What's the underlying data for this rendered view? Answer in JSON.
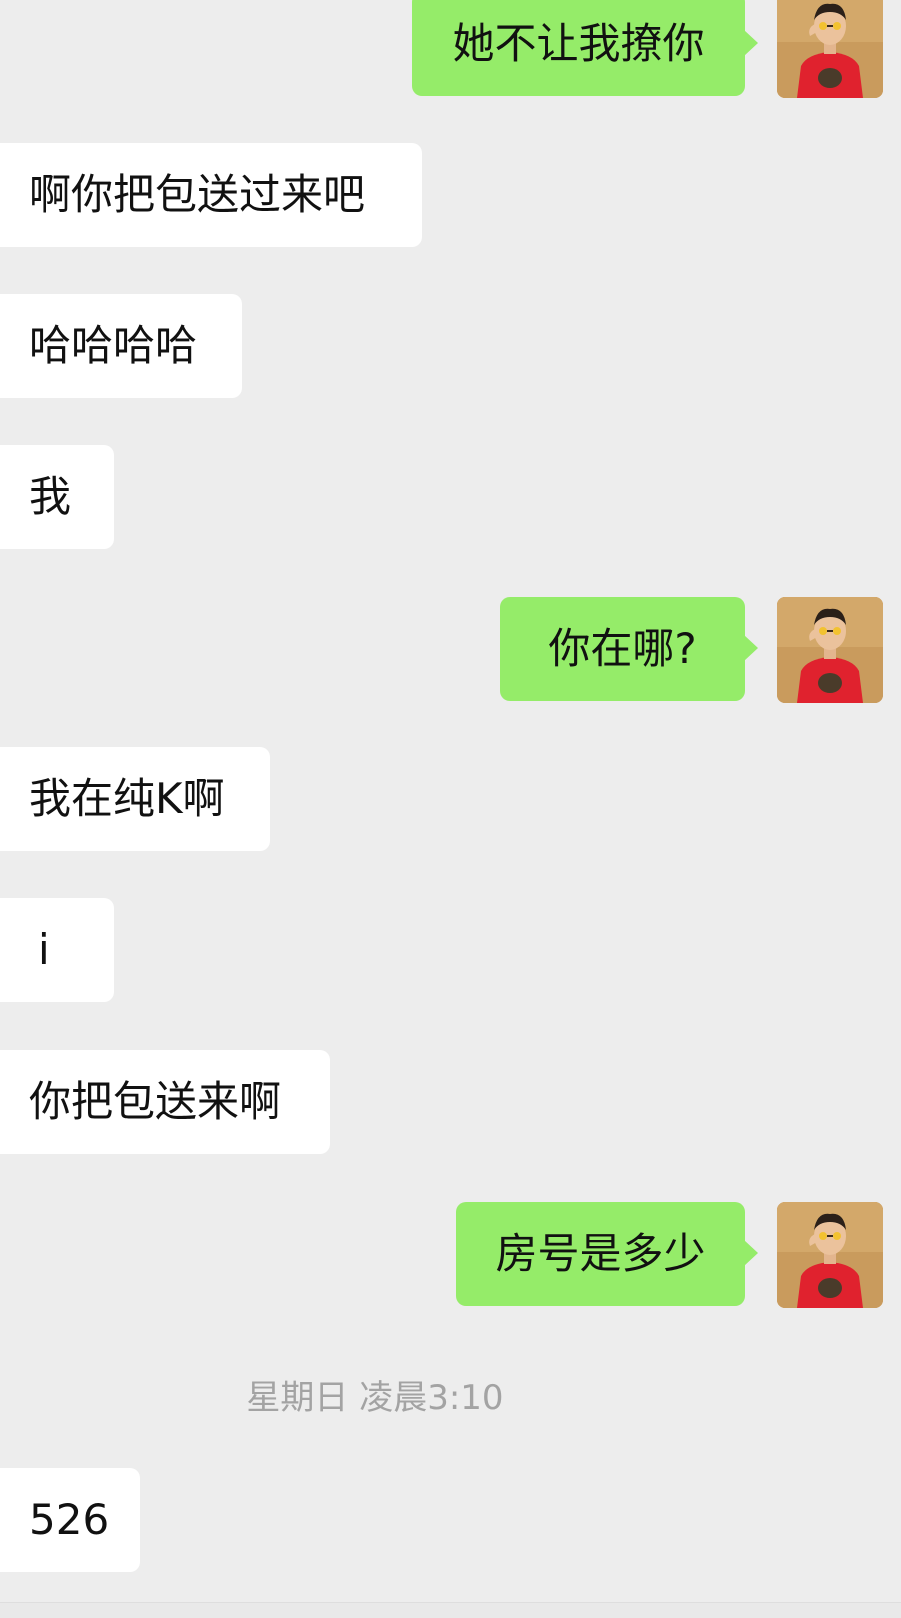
{
  "colors": {
    "background": "#ededed",
    "incoming_bubble": "#ffffff",
    "outgoing_bubble": "#95ec69",
    "timestamp_text": "#a3a3a3"
  },
  "messages": [
    {
      "from": "me",
      "text": "她不让我撩你"
    },
    {
      "from": "them",
      "text": "啊你把包送过来吧"
    },
    {
      "from": "them",
      "text": "哈哈哈哈"
    },
    {
      "from": "them",
      "text": "我"
    },
    {
      "from": "me",
      "text": "你在哪?"
    },
    {
      "from": "them",
      "text": "我在纯K啊"
    },
    {
      "from": "them",
      "text": "i"
    },
    {
      "from": "them",
      "text": "你把包送来啊"
    },
    {
      "from": "me",
      "text": "房号是多少"
    },
    {
      "from": "them",
      "text": "526"
    }
  ],
  "timestamp": "星期日 凌晨3:10",
  "avatar_icon": "user-avatar-photo"
}
